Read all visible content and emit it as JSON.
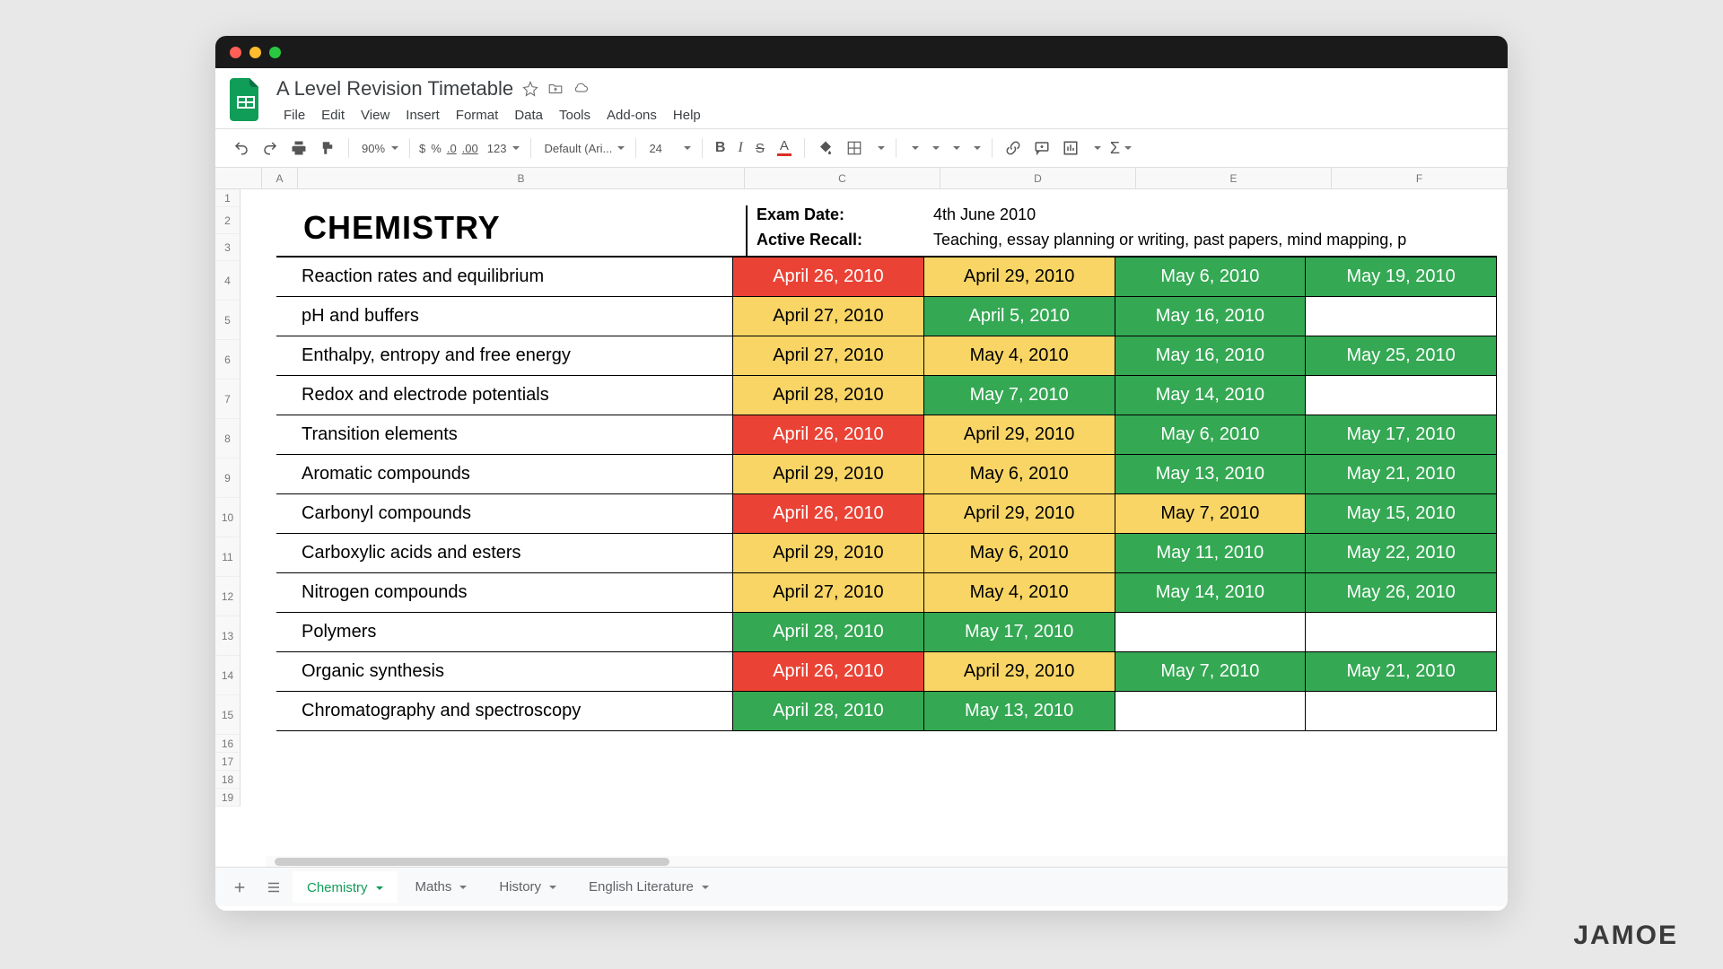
{
  "doc_title": "A Level Revision Timetable",
  "menu": [
    "File",
    "Edit",
    "View",
    "Insert",
    "Format",
    "Data",
    "Tools",
    "Add-ons",
    "Help"
  ],
  "toolbar": {
    "zoom": "90%",
    "symbols": {
      "currency": "$",
      "percent": "%",
      "dec_dec": ".0",
      "inc_dec": ".00",
      "more": "123"
    },
    "font": "Default (Ari...",
    "font_size": "24"
  },
  "columns": [
    "A",
    "B",
    "C",
    "D",
    "E",
    "F"
  ],
  "row_numbers": [
    "1",
    "2",
    "3",
    "4",
    "5",
    "6",
    "7",
    "8",
    "9",
    "10",
    "11",
    "12",
    "13",
    "14",
    "15",
    "16",
    "17",
    "18",
    "19"
  ],
  "title": "CHEMISTRY",
  "info": {
    "exam_date_label": "Exam Date:",
    "exam_date_value": "4th June 2010",
    "active_recall_label": "Active Recall:",
    "active_recall_value": "Teaching, essay planning or writing, past papers, mind mapping, p"
  },
  "rows": [
    {
      "topic": "Reaction rates and equilibrium",
      "cells": [
        {
          "v": "April 26, 2010",
          "c": "red"
        },
        {
          "v": "April 29, 2010",
          "c": "yellow"
        },
        {
          "v": "May 6, 2010",
          "c": "green"
        },
        {
          "v": "May 19, 2010",
          "c": "green"
        }
      ]
    },
    {
      "topic": "pH and buffers",
      "cells": [
        {
          "v": "April 27, 2010",
          "c": "yellow"
        },
        {
          "v": "April 5, 2010",
          "c": "green"
        },
        {
          "v": "May 16, 2010",
          "c": "green"
        },
        {
          "v": "",
          "c": "white"
        }
      ]
    },
    {
      "topic": "Enthalpy, entropy and free energy",
      "cells": [
        {
          "v": "April 27, 2010",
          "c": "yellow"
        },
        {
          "v": "May 4, 2010",
          "c": "yellow"
        },
        {
          "v": "May 16, 2010",
          "c": "green"
        },
        {
          "v": "May 25, 2010",
          "c": "green"
        }
      ]
    },
    {
      "topic": "Redox and electrode potentials",
      "cells": [
        {
          "v": "April 28, 2010",
          "c": "yellow"
        },
        {
          "v": "May 7, 2010",
          "c": "green"
        },
        {
          "v": "May 14, 2010",
          "c": "green"
        },
        {
          "v": "",
          "c": "white"
        }
      ]
    },
    {
      "topic": "Transition elements",
      "cells": [
        {
          "v": "April 26, 2010",
          "c": "red"
        },
        {
          "v": "April 29, 2010",
          "c": "yellow"
        },
        {
          "v": "May 6, 2010",
          "c": "green"
        },
        {
          "v": "May 17, 2010",
          "c": "green"
        }
      ]
    },
    {
      "topic": "Aromatic compounds",
      "cells": [
        {
          "v": "April 29, 2010",
          "c": "yellow"
        },
        {
          "v": "May 6, 2010",
          "c": "yellow"
        },
        {
          "v": "May 13, 2010",
          "c": "green"
        },
        {
          "v": "May 21, 2010",
          "c": "green"
        }
      ]
    },
    {
      "topic": "Carbonyl compounds",
      "cells": [
        {
          "v": "April 26, 2010",
          "c": "red"
        },
        {
          "v": "April 29, 2010",
          "c": "yellow"
        },
        {
          "v": "May 7, 2010",
          "c": "yellow"
        },
        {
          "v": "May 15, 2010",
          "c": "green"
        }
      ]
    },
    {
      "topic": "Carboxylic acids and esters",
      "cells": [
        {
          "v": "April 29, 2010",
          "c": "yellow"
        },
        {
          "v": "May 6, 2010",
          "c": "yellow"
        },
        {
          "v": "May 11, 2010",
          "c": "green"
        },
        {
          "v": "May 22, 2010",
          "c": "green"
        }
      ]
    },
    {
      "topic": "Nitrogen compounds",
      "cells": [
        {
          "v": "April 27, 2010",
          "c": "yellow"
        },
        {
          "v": "May 4, 2010",
          "c": "yellow"
        },
        {
          "v": "May 14, 2010",
          "c": "green"
        },
        {
          "v": "May 26, 2010",
          "c": "green"
        }
      ]
    },
    {
      "topic": "Polymers",
      "cells": [
        {
          "v": "April 28, 2010",
          "c": "green"
        },
        {
          "v": "May 17, 2010",
          "c": "green"
        },
        {
          "v": "",
          "c": "white"
        },
        {
          "v": "",
          "c": "white"
        }
      ]
    },
    {
      "topic": "Organic synthesis",
      "cells": [
        {
          "v": "April 26, 2010",
          "c": "red"
        },
        {
          "v": "April 29, 2010",
          "c": "yellow"
        },
        {
          "v": "May 7, 2010",
          "c": "green"
        },
        {
          "v": "May 21, 2010",
          "c": "green"
        }
      ]
    },
    {
      "topic": "Chromatography and spectroscopy",
      "cells": [
        {
          "v": "April 28, 2010",
          "c": "green"
        },
        {
          "v": "May 13, 2010",
          "c": "green"
        },
        {
          "v": "",
          "c": "white"
        },
        {
          "v": "",
          "c": "white"
        }
      ]
    }
  ],
  "tabs": [
    {
      "label": "Chemistry",
      "active": true
    },
    {
      "label": "Maths",
      "active": false
    },
    {
      "label": "History",
      "active": false
    },
    {
      "label": "English Literature",
      "active": false
    }
  ],
  "watermark": "JAMOE"
}
